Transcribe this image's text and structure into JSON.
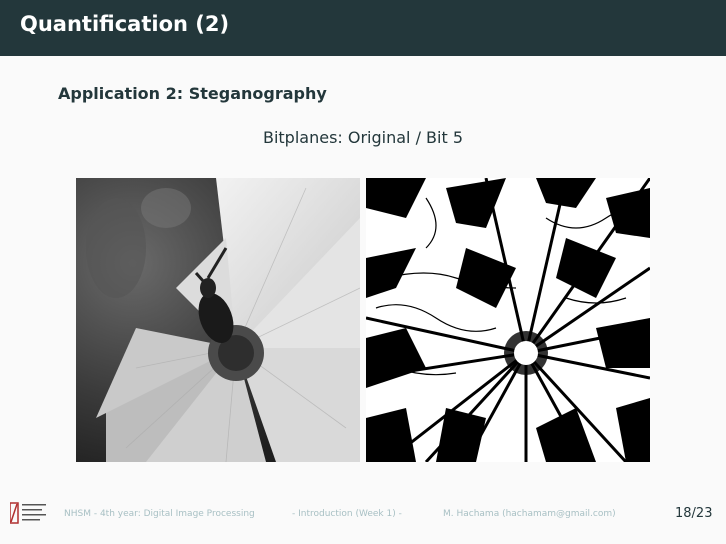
{
  "slide": {
    "title": "Quantification (2)",
    "subtitle": "Application 2: Steganography",
    "caption": "Bitplanes: Original / Bit 5"
  },
  "images": [
    {
      "name": "original-flower-image",
      "description_shown": "grayscale photo of a white flower with a bee"
    },
    {
      "name": "bitplane-5-image",
      "description_shown": "binary bit plane 5 of the flower photo"
    }
  ],
  "footer": {
    "course": "NHSM - 4th year: Digital Image Processing",
    "section": "- Introduction (Week 1) -",
    "author": "M. Hachama (hachamam@gmail.com)",
    "page": "18/23"
  },
  "colors": {
    "title_bar": "#23373b",
    "text": "#23373b",
    "footer_text": "#a8c0c4",
    "background": "#fafafa"
  },
  "icons": [
    "institution-logo-icon"
  ]
}
